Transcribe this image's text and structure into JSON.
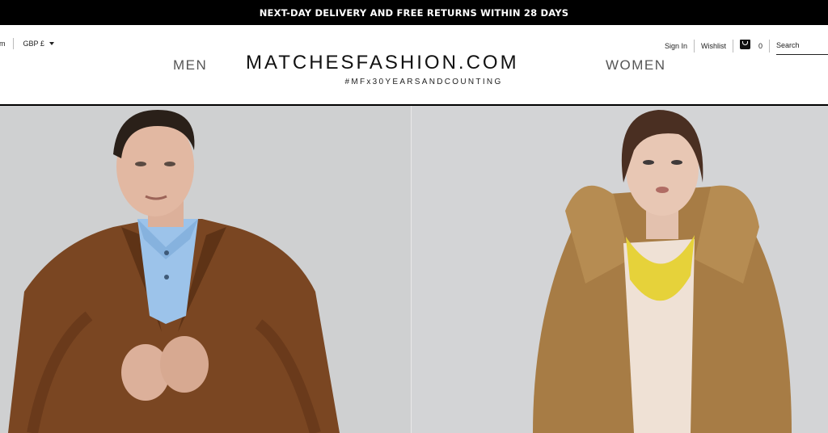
{
  "promo": {
    "text": "NEXT-DAY DELIVERY AND FREE RETURNS WITHIN 28 DAYS"
  },
  "header": {
    "country_label": "om",
    "currency_label": "GBP £",
    "sign_in": "Sign In",
    "wishlist": "Wishlist",
    "bag_count": "0",
    "search_placeholder": "Search",
    "logo": "MATCHESFASHION.COM",
    "hashtag": "#MFx30YEARSANDCOUNTING",
    "nav_men": "MEN",
    "nav_women": "WOMEN"
  },
  "colors": {
    "promo_bg": "#000000",
    "men_backdrop": "#cfd0d1",
    "women_backdrop": "#d3d4d6",
    "men_coat": "#7a4622",
    "men_shirt": "#9cc3ea",
    "women_coat": "#a77c45",
    "women_necklace": "#e6d23a"
  },
  "icons": {
    "bag": "shopping-bag-icon",
    "currency_caret": "chevron-down-icon"
  }
}
